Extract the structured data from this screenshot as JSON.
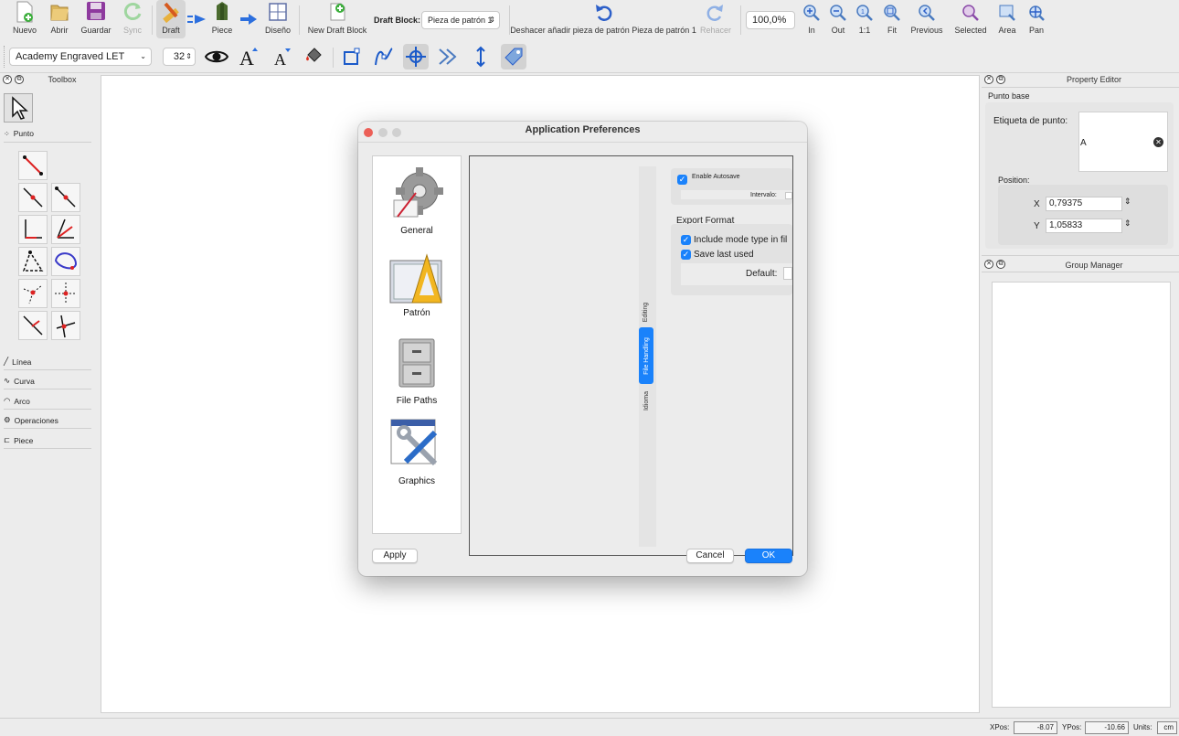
{
  "toolbar": {
    "nuevo": "Nuevo",
    "abrir": "Abrir",
    "guardar": "Guardar",
    "sync": "Sync",
    "draft": "Draft",
    "piece": "Piece",
    "diseno": "Diseño",
    "new_draft_block": "New Draft Block",
    "draft_block_label": "Draft Block:",
    "draft_block_value": "Pieza de patrón 1",
    "undo": "Deshacer añadir pieza de patrón Pieza de patrón 1",
    "redo": "Rehacer",
    "zoom_value": "100,0%",
    "zoom_in": "In",
    "zoom_out": "Out",
    "zoom_1to1": "1:1",
    "zoom_fit": "Fit",
    "zoom_previous": "Previous",
    "zoom_selected": "Selected",
    "zoom_area": "Area",
    "pan": "Pan"
  },
  "text_toolbar": {
    "font": "Academy Engraved LET",
    "font_size": "32"
  },
  "toolbox": {
    "title": "Toolbox",
    "groups": {
      "punto": "Punto",
      "linea": "Línea",
      "curva": "Curva",
      "arco": "Arco",
      "operaciones": "Operaciones",
      "piece": "Piece"
    }
  },
  "property_editor": {
    "title": "Property Editor",
    "section": "Punto base",
    "label_caption": "Etiqueta de punto:",
    "label_value": "A",
    "position_caption": "Position:",
    "x_label": "X",
    "x_value": "0,79375",
    "y_label": "Y",
    "y_value": "1,05833"
  },
  "group_manager": {
    "title": "Group Manager"
  },
  "status": {
    "xpos_label": "XPos:",
    "xpos_value": "-8.07",
    "ypos_label": "YPos:",
    "ypos_value": "-10.66",
    "units_label": "Units:",
    "units_value": "cm"
  },
  "dialog": {
    "title": "Application Preferences",
    "categories": {
      "general": "General",
      "patron": "Patrón",
      "file_paths": "File Paths",
      "graphics": "Graphics"
    },
    "tabs": {
      "editing": "Editing",
      "file_handling": "File Handling",
      "idioma": "Idioma"
    },
    "autosave_label": "Enable Autosave",
    "interval_label": "Intervalo:",
    "export_header": "Export Format",
    "include_mode": "Include mode type in fil",
    "save_last": "Save last used",
    "default_label": "Default:",
    "apply": "Apply",
    "cancel": "Cancel",
    "ok": "OK"
  },
  "colors": {
    "accent": "#1a82fb",
    "close_light": "#ec5f57"
  }
}
